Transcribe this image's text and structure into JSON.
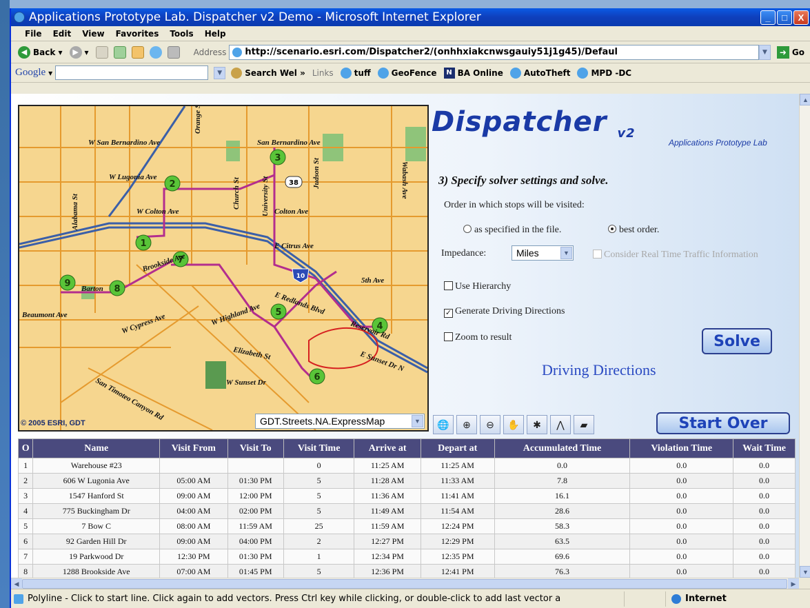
{
  "window": {
    "title": "Applications Prototype Lab. Dispatcher v2 Demo - Microsoft Internet Explorer",
    "buttons": {
      "minimize": "_",
      "maximize": "□",
      "close": "X"
    }
  },
  "menu": [
    "File",
    "Edit",
    "View",
    "Favorites",
    "Tools",
    "Help"
  ],
  "toolbar": {
    "back_label": "Back",
    "address_label": "Address",
    "address_value": "http://scenario.esri.com/Dispatcher2/(onhhxiakcnwsgauiy51j1g45)/Defaul",
    "go_label": "Go"
  },
  "googlebar": {
    "logo": "Google",
    "search_label": "Search Wel",
    "links_label": "Links",
    "links": [
      "tuff",
      "GeoFence",
      "BA Online",
      "AutoTheft",
      "MPD -DC"
    ]
  },
  "map": {
    "copyright": "© 2005 ESRI, GDT",
    "layer_select": "GDT.Streets.NA.ExpressMap",
    "street_labels": [
      "W San Bernardino Ave",
      "San Bernardino Ave",
      "W Lugonia Ave",
      "W Colton Ave",
      "Colton Ave",
      "E Citrus Ave",
      "Brookside Ave",
      "Barton",
      "Beaumont Ave",
      "W Cypress Ave",
      "W Highland Ave",
      "E Redlands Blvd",
      "5th Ave",
      "Elizabeth St",
      "W Sunset Dr",
      "San Timoteo Canyon Rd",
      "Orange St",
      "Alabama St",
      "Judson St",
      "Wabash Ave",
      "Church St",
      "University St",
      "Reservoir Rd",
      "E Sunset Dr N"
    ],
    "stops": [
      "1",
      "2",
      "3",
      "4",
      "5",
      "6",
      "7",
      "8",
      "9"
    ],
    "route_shield": "38",
    "interstate": "10"
  },
  "panel": {
    "brand": "Dispatcher",
    "brand_version": "v2",
    "lab": "Applications Prototype Lab",
    "step": "3) Specify solver settings and solve.",
    "order_label": "Order in which stops will be visited:",
    "radio_specified": "as specified in the file.",
    "radio_best": "best order.",
    "impedance_label": "Impedance:",
    "impedance_value": "Miles",
    "realtime_label": "Consider Real Time Traffic Information",
    "hierarchy_label": "Use Hierarchy",
    "directions_label": "Generate Driving Directions",
    "zoom_label": "Zoom to result",
    "solve_label": "Solve",
    "driving_directions": "Driving Directions",
    "start_over": "Start Over"
  },
  "table": {
    "headers": [
      "O",
      "Name",
      "Visit From",
      "Visit To",
      "Visit Time",
      "Arrive at",
      "Depart at",
      "Accumulated Time",
      "Violation Time",
      "Wait Time"
    ],
    "rows": [
      [
        "1",
        "Warehouse #23",
        "",
        "",
        "0",
        "11:25 AM",
        "11:25 AM",
        "0.0",
        "0.0",
        "0.0"
      ],
      [
        "2",
        "606 W Lugonia Ave",
        "05:00 AM",
        "01:30 PM",
        "5",
        "11:28 AM",
        "11:33 AM",
        "7.8",
        "0.0",
        "0.0"
      ],
      [
        "3",
        "1547 Hanford St",
        "09:00 AM",
        "12:00 PM",
        "5",
        "11:36 AM",
        "11:41 AM",
        "16.1",
        "0.0",
        "0.0"
      ],
      [
        "4",
        "775 Buckingham Dr",
        "04:00 AM",
        "02:00 PM",
        "5",
        "11:49 AM",
        "11:54 AM",
        "28.6",
        "0.0",
        "0.0"
      ],
      [
        "5",
        "7 Bow C",
        "08:00 AM",
        "11:59 AM",
        "25",
        "11:59 AM",
        "12:24 PM",
        "58.3",
        "0.0",
        "0.0"
      ],
      [
        "6",
        "92 Garden Hill Dr",
        "09:00 AM",
        "04:00 PM",
        "2",
        "12:27 PM",
        "12:29 PM",
        "63.5",
        "0.0",
        "0.0"
      ],
      [
        "7",
        "19 Parkwood Dr",
        "12:30 PM",
        "01:30 PM",
        "1",
        "12:34 PM",
        "12:35 PM",
        "69.6",
        "0.0",
        "0.0"
      ],
      [
        "8",
        "1288 Brookside Ave",
        "07:00 AM",
        "01:45 PM",
        "5",
        "12:36 PM",
        "12:41 PM",
        "76.3",
        "0.0",
        "0.0"
      ]
    ]
  },
  "status": {
    "message": "Polyline - Click to start line. Click again to add vectors. Press Ctrl key while clicking, or double-click to add last vector a",
    "zone": "Internet"
  }
}
